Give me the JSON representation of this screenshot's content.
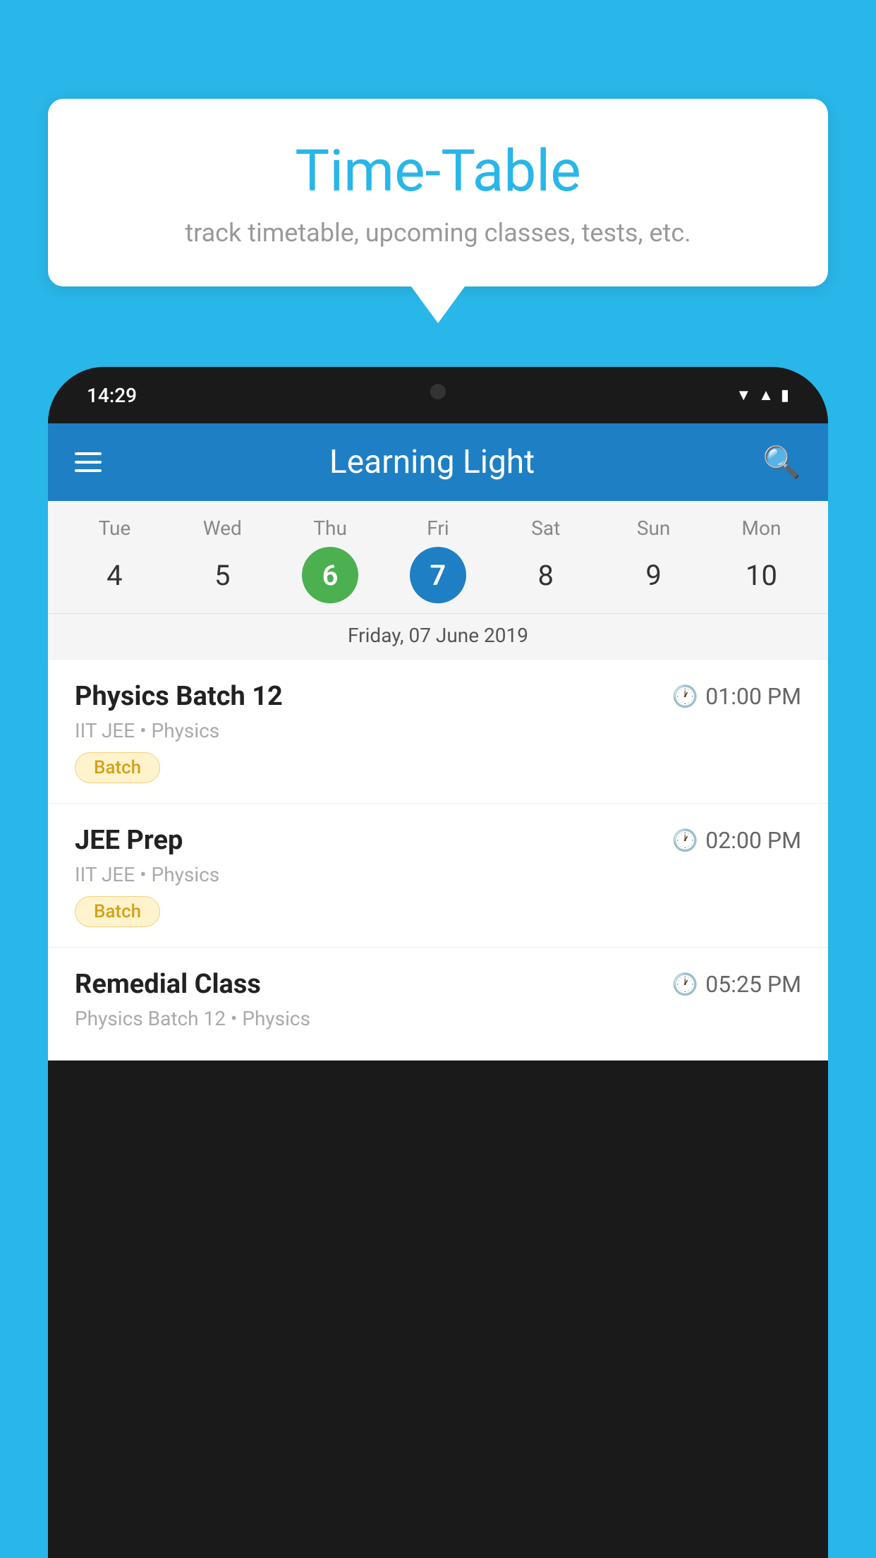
{
  "background_color": "#29b6e8",
  "speech_bubble": {
    "title": "Time-Table",
    "subtitle": "track timetable, upcoming classes, tests, etc."
  },
  "phone": {
    "status_bar": {
      "time": "14:29"
    },
    "app_bar": {
      "title": "Learning Light",
      "menu_label": "Menu",
      "search_label": "Search"
    },
    "calendar": {
      "days": [
        {
          "name": "Tue",
          "num": "4",
          "state": "normal"
        },
        {
          "name": "Wed",
          "num": "5",
          "state": "normal"
        },
        {
          "name": "Thu",
          "num": "6",
          "state": "today"
        },
        {
          "name": "Fri",
          "num": "7",
          "state": "selected"
        },
        {
          "name": "Sat",
          "num": "8",
          "state": "normal"
        },
        {
          "name": "Sun",
          "num": "9",
          "state": "normal"
        },
        {
          "name": "Mon",
          "num": "10",
          "state": "normal"
        }
      ],
      "selected_date_label": "Friday, 07 June 2019"
    },
    "schedule": {
      "items": [
        {
          "title": "Physics Batch 12",
          "time": "01:00 PM",
          "subtitle": "IIT JEE • Physics",
          "badge": "Batch"
        },
        {
          "title": "JEE Prep",
          "time": "02:00 PM",
          "subtitle": "IIT JEE • Physics",
          "badge": "Batch"
        },
        {
          "title": "Remedial Class",
          "time": "05:25 PM",
          "subtitle": "Physics Batch 12 • Physics",
          "badge": ""
        }
      ]
    }
  }
}
